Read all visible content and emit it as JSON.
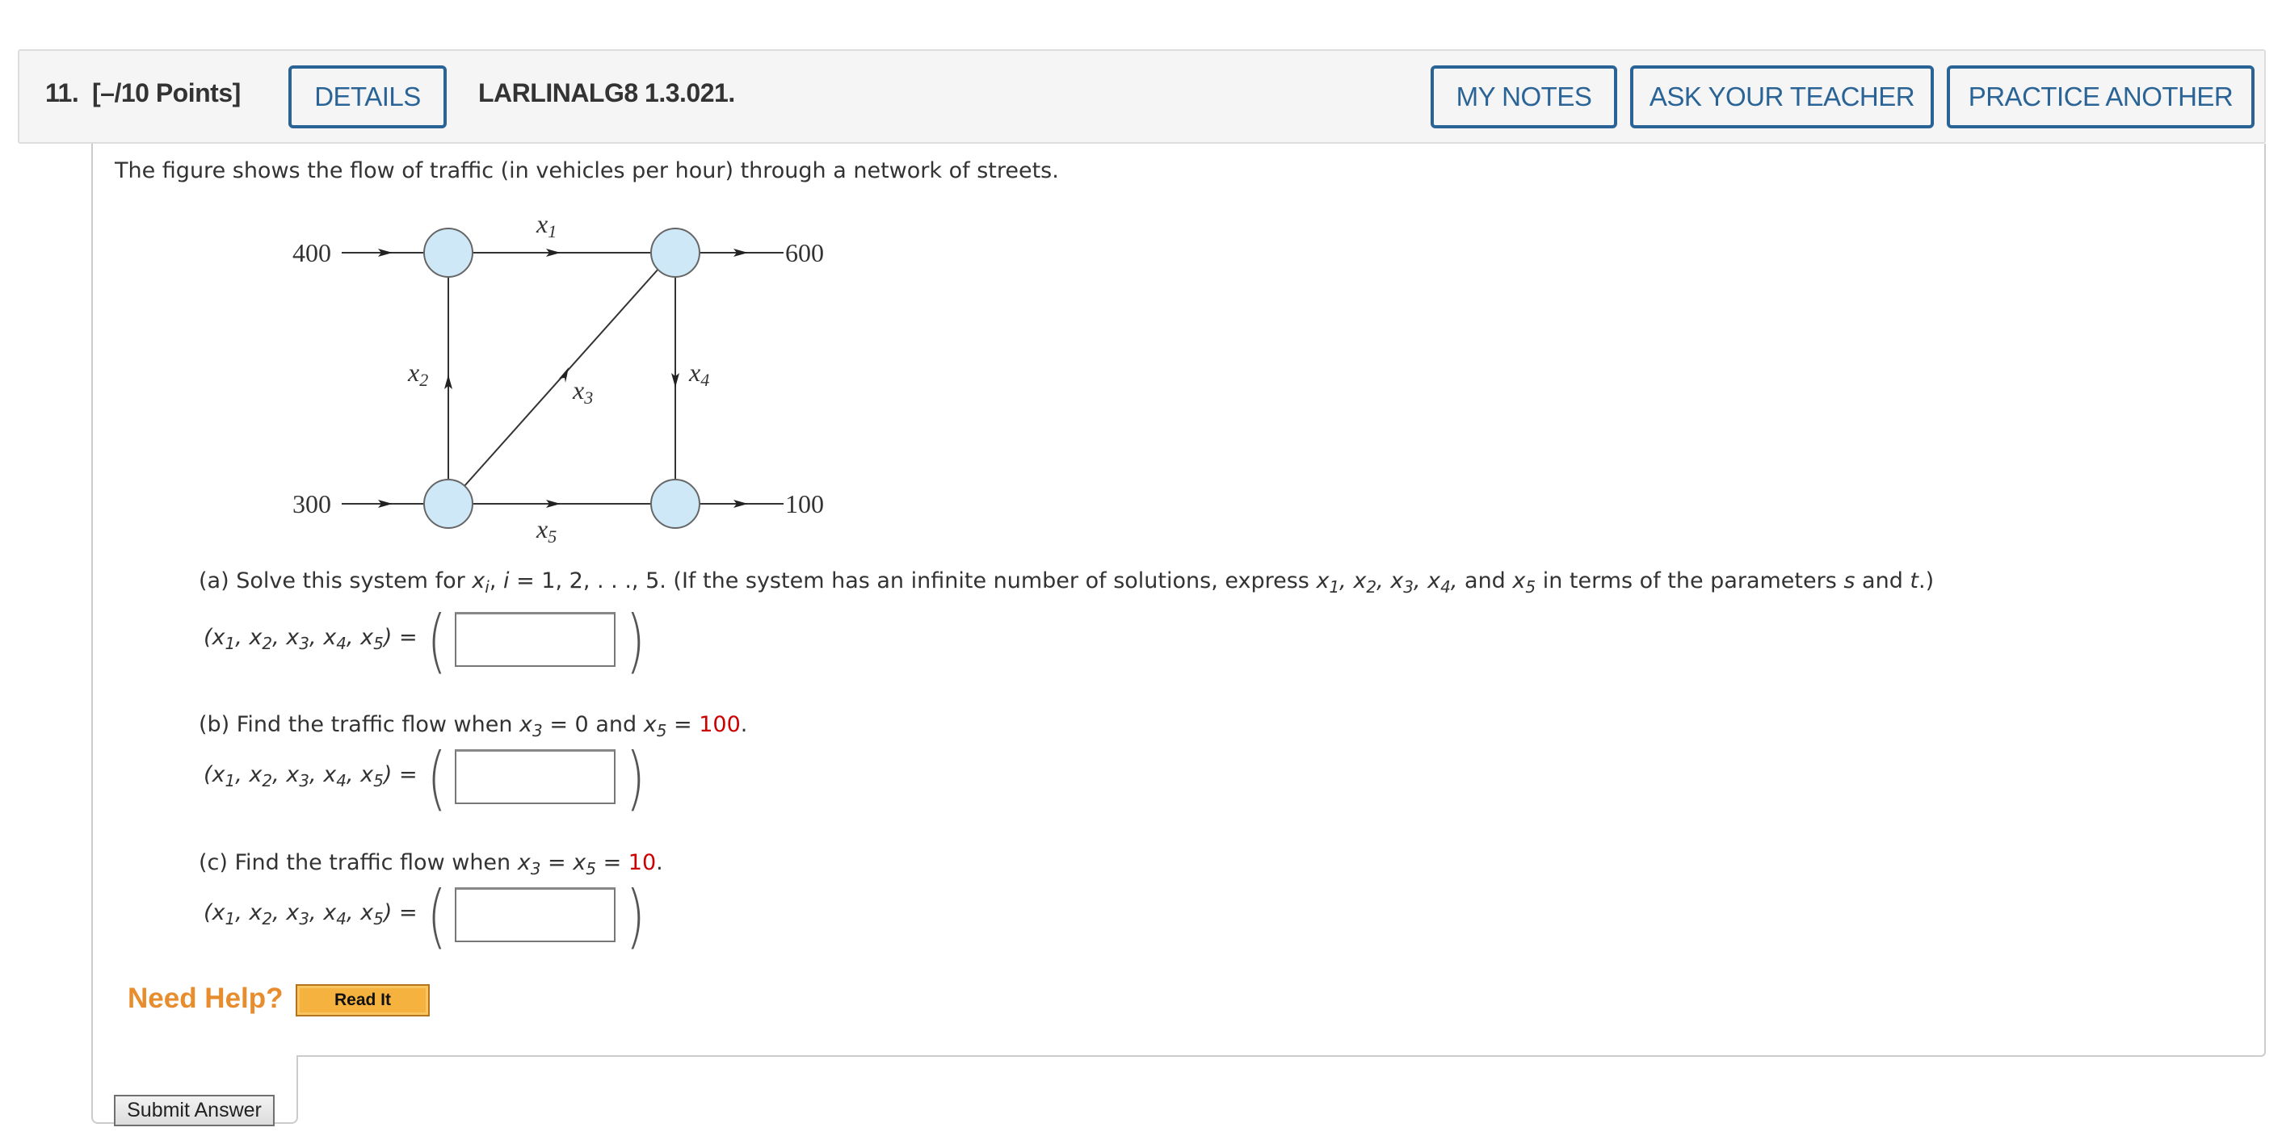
{
  "header": {
    "question_number": "11.",
    "points": "[–/10 Points]",
    "details_button": "DETAILS",
    "question_code": "LARLINALG8 1.3.021.",
    "my_notes_button": "MY NOTES",
    "ask_teacher_button": "ASK YOUR TEACHER",
    "practice_another_button": "PRACTICE ANOTHER"
  },
  "problem": {
    "intro": "The figure shows the flow of traffic (in vehicles per hour) through a network of streets."
  },
  "diagram": {
    "inflows": {
      "top_left": "400",
      "bottom_left": "300"
    },
    "outflows": {
      "top_right": "600",
      "bottom_right": "100"
    },
    "edges": {
      "x1": {
        "var": "x",
        "sub": "1",
        "direction": "top-left to top-right"
      },
      "x2": {
        "var": "x",
        "sub": "2",
        "direction": "bottom-left to top-left"
      },
      "x3": {
        "var": "x",
        "sub": "3",
        "direction": "bottom-left to top-right"
      },
      "x4": {
        "var": "x",
        "sub": "4",
        "direction": "top-right to bottom-right"
      },
      "x5": {
        "var": "x",
        "sub": "5",
        "direction": "bottom-left to bottom-right"
      }
    },
    "node_color": "#cfe8f7"
  },
  "parts": {
    "a": {
      "prefix": "(a) Solve this system for ",
      "xi": "x",
      "i_sub": "i",
      "mid": ", ",
      "i": "i",
      "range": " = 1, 2, . . ., 5.  (If the system has an infinite number of solutions, express ",
      "vars_tail": " in terms of the parameters ",
      "s": "s",
      "and": " and ",
      "t": "t",
      "end": ".)",
      "answer_value": ""
    },
    "b": {
      "prefix": "(b) Find the traffic flow when ",
      "cond1": " = 0  and ",
      "cond2_eq": " = ",
      "value": "100",
      "end": ".",
      "answer_value": ""
    },
    "c": {
      "prefix": "(c) Find the traffic flow when ",
      "eq": " = ",
      "value": "10",
      "end": ".",
      "answer_value": ""
    },
    "tuple_label": "(x1, x2, x3, x4, x5) ="
  },
  "help": {
    "need_help": "Need Help?",
    "read_it_button": "Read It"
  },
  "submit_button": "Submit Answer",
  "colors": {
    "accent_blue": "#2a6496",
    "given_value_red": "#cc0000",
    "need_help_orange": "#e88d2e",
    "read_it_fill": "#f6b23e"
  }
}
